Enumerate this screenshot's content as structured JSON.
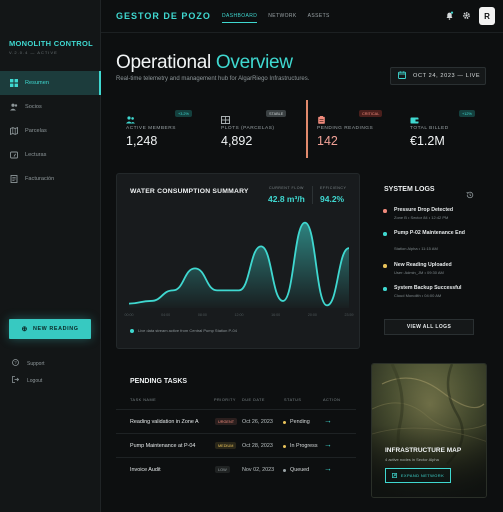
{
  "sidebar": {
    "brand": "MONOLITH CONTROL",
    "brand_sub": "V.2.0.4 — ACTIVE",
    "items": [
      {
        "label": "Resumen",
        "icon": "grid-icon",
        "active": true
      },
      {
        "label": "Socios",
        "icon": "users-icon",
        "active": false
      },
      {
        "label": "Parcelas",
        "icon": "map-icon",
        "active": false
      },
      {
        "label": "Lecturas",
        "icon": "gauge-icon",
        "active": false
      },
      {
        "label": "Facturación",
        "icon": "invoice-icon",
        "active": false
      }
    ],
    "new_reading": "NEW READING",
    "support": "Support",
    "logout": "Logout"
  },
  "topbar": {
    "title": "GESTOR DE POZO",
    "tabs": [
      {
        "label": "DASHBOARD",
        "active": true
      },
      {
        "label": "NETWORK",
        "active": false
      },
      {
        "label": "ASSETS",
        "active": false
      }
    ],
    "avatar_initial": "R"
  },
  "header": {
    "title_main": "Operational",
    "title_highlight": "Overview",
    "subtitle": "Real-time telemetry and management hub for AlgarRiego Infrastructures.",
    "date": "OCT 24, 2023 — LIVE"
  },
  "stats": [
    {
      "label": "ACTIVE MEMBERS",
      "value": "1,248",
      "badge": "+3.2%",
      "badge_color": "#3fd8d0",
      "icon": "members-icon"
    },
    {
      "label": "PLOTS (PARCELAS)",
      "value": "4,892",
      "badge": "STABLE",
      "badge_color": "#9aa3a6",
      "icon": "plots-icon"
    },
    {
      "label": "PENDING READINGS",
      "value": "142",
      "badge": "CRITICAL",
      "badge_color": "#f08a7c",
      "icon": "clipboard-icon"
    },
    {
      "label": "TOTAL BILLED",
      "value": "€1.2M",
      "badge": "+12%",
      "badge_color": "#3fd8d0",
      "icon": "wallet-icon"
    }
  ],
  "water": {
    "title": "WATER CONSUMPTION SUMMARY",
    "flow_label": "CURRENT FLOW",
    "flow_value": "42.8 m³/h",
    "eff_label": "EFFICIENCY",
    "eff_value": "94.2%",
    "legend": "Live data stream active from Central Pump Station P-04",
    "x_ticks": [
      "00:00",
      "04:00",
      "08:00",
      "12:00",
      "16:00",
      "20:00",
      "23:59"
    ]
  },
  "chart_data": {
    "type": "area",
    "series": [
      {
        "values": [
          0.05,
          0.08,
          0.2,
          0.45,
          0.2,
          0.2,
          0.7,
          0.08,
          0.97,
          0.03,
          0.68
        ]
      }
    ],
    "color": "#3fd8d0"
  },
  "logs": {
    "title": "SYSTEM LOGS",
    "entries": [
      {
        "title": "Pressure Drop Detected",
        "meta": "Zone B • Sector 84 • 12:42 PM",
        "color": "#f08a7c"
      },
      {
        "title": "Pump P-02 Maintenance End",
        "meta": "Station Alpha • 11:15 AM",
        "color": "#3fd8d0"
      },
      {
        "title": "New Reading Uploaded",
        "meta": "User: Admin_JM • 09:30 AM",
        "color": "#e8c25a"
      },
      {
        "title": "System Backup Successful",
        "meta": "Cloud Monolith • 04:00 AM",
        "color": "#3fd8d0"
      }
    ],
    "view_all": "VIEW ALL LOGS"
  },
  "tasks": {
    "title": "PENDING TASKS",
    "headers": [
      "TASK NAME",
      "PRIORITY",
      "DUE DATE",
      "STATUS",
      "ACTION"
    ],
    "rows": [
      {
        "name": "Reading validation in Zone A",
        "priority": "URGENT",
        "pcolor": "#f08a7c",
        "due": "Oct 26, 2023",
        "status": "Pending",
        "scolor": "#e8c25a"
      },
      {
        "name": "Pump Maintenance at P-04",
        "priority": "MEDIUM",
        "pcolor": "#e8c25a",
        "due": "Oct 28, 2023",
        "status": "In Progress",
        "scolor": "#e8c25a"
      },
      {
        "name": "Invoice Audit",
        "priority": "LOW",
        "pcolor": "#9aa3a6",
        "due": "Nov 02, 2023",
        "status": "Queued",
        "scolor": "#9aa3a6"
      }
    ]
  },
  "map": {
    "title": "INFRASTRUCTURE MAP",
    "subtitle": "4 active nodes in Sector Alpha",
    "button": "EXPAND NETWORK"
  }
}
